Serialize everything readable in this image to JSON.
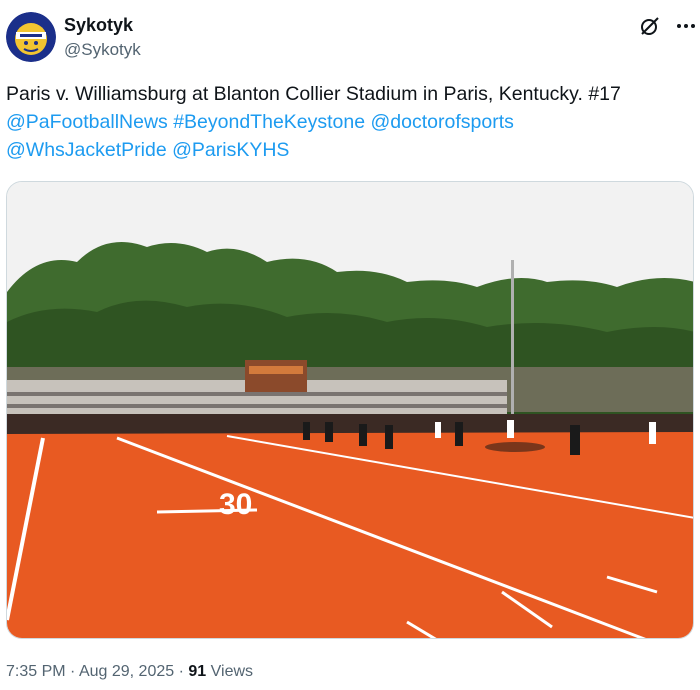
{
  "author": {
    "display_name": "Sykotyk",
    "handle": "@Sykotyk",
    "avatar_icon": "avatar-logo"
  },
  "actions": {
    "grok_icon": "grok-icon",
    "more_icon": "more-options-icon"
  },
  "tweet": {
    "text_prefix": "Paris v. Williamsburg at Blanton Collier Stadium in Paris, Kentucky. #17",
    "mentions": [
      "@PaFootballNews",
      "#BeyondTheKeystone",
      "@doctorofsports",
      "@WhsJacketPride",
      "@ParisKYHS"
    ],
    "media": {
      "type": "photo",
      "yard_number": "30",
      "colors": {
        "field": "#e85a22",
        "sky": "#f2f2f2",
        "trees": "#3f6b2e"
      }
    }
  },
  "meta": {
    "time": "7:35 PM",
    "separator": "·",
    "date": "Aug 29, 2025",
    "views_count": "91",
    "views_label": "Views"
  }
}
